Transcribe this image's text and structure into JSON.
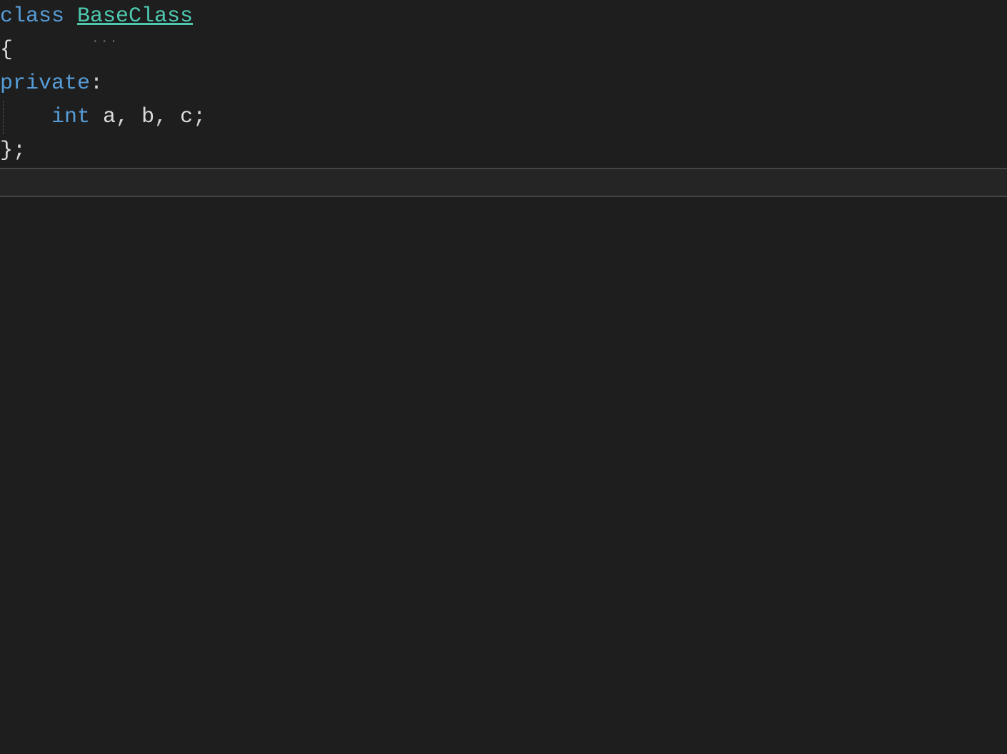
{
  "code": {
    "line1": {
      "keyword": "class",
      "space": " ",
      "className": "BaseClass"
    },
    "line2": {
      "brace": "{"
    },
    "line3": {
      "keyword": "private",
      "colon": ":"
    },
    "line4": {
      "indent": "    ",
      "type": "int",
      "space1": " ",
      "var1": "a",
      "comma1": ",",
      "space2": " ",
      "var2": "b",
      "comma2": ",",
      "space3": " ",
      "var3": "c",
      "semicolon": ";"
    },
    "line5": {
      "brace": "}",
      "semicolon": ";"
    }
  },
  "hint": "···"
}
